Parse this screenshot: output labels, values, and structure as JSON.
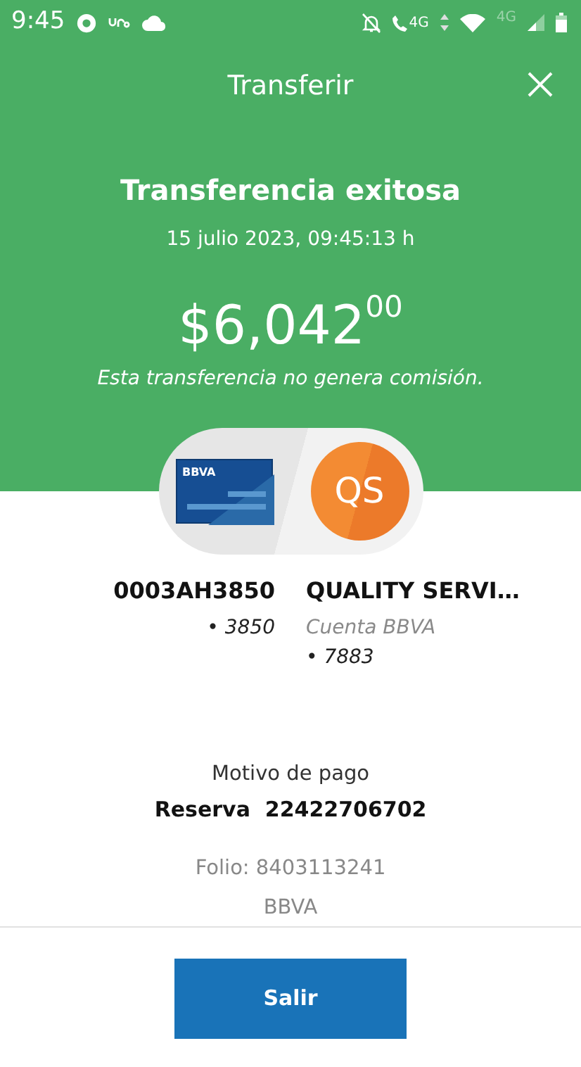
{
  "status_bar": {
    "time": "9:45",
    "call_network": "4G",
    "data_network": "4G"
  },
  "header": {
    "title": "Transferir"
  },
  "result": {
    "title": "Transferencia exitosa",
    "datetime": "15 julio 2023, 09:45:13 h",
    "amount": "$6,042$^{00}$",
    "note": "Esta transferencia no genera comisión."
  },
  "origin": {
    "card_brand": "BBVA",
    "name": "0003AH3850",
    "account": "• 3850"
  },
  "destination": {
    "initials": "QS",
    "name": "QUALITY SERVI…",
    "bank": "Cuenta BBVA",
    "account": "• 7883"
  },
  "payment_reason": {
    "label": "Motivo de pago",
    "value": "Reserva  22422706702"
  },
  "info_lines": [
    "Folio: 8403113241",
    "BBVA"
  ],
  "footer": {
    "button": "Salir"
  }
}
